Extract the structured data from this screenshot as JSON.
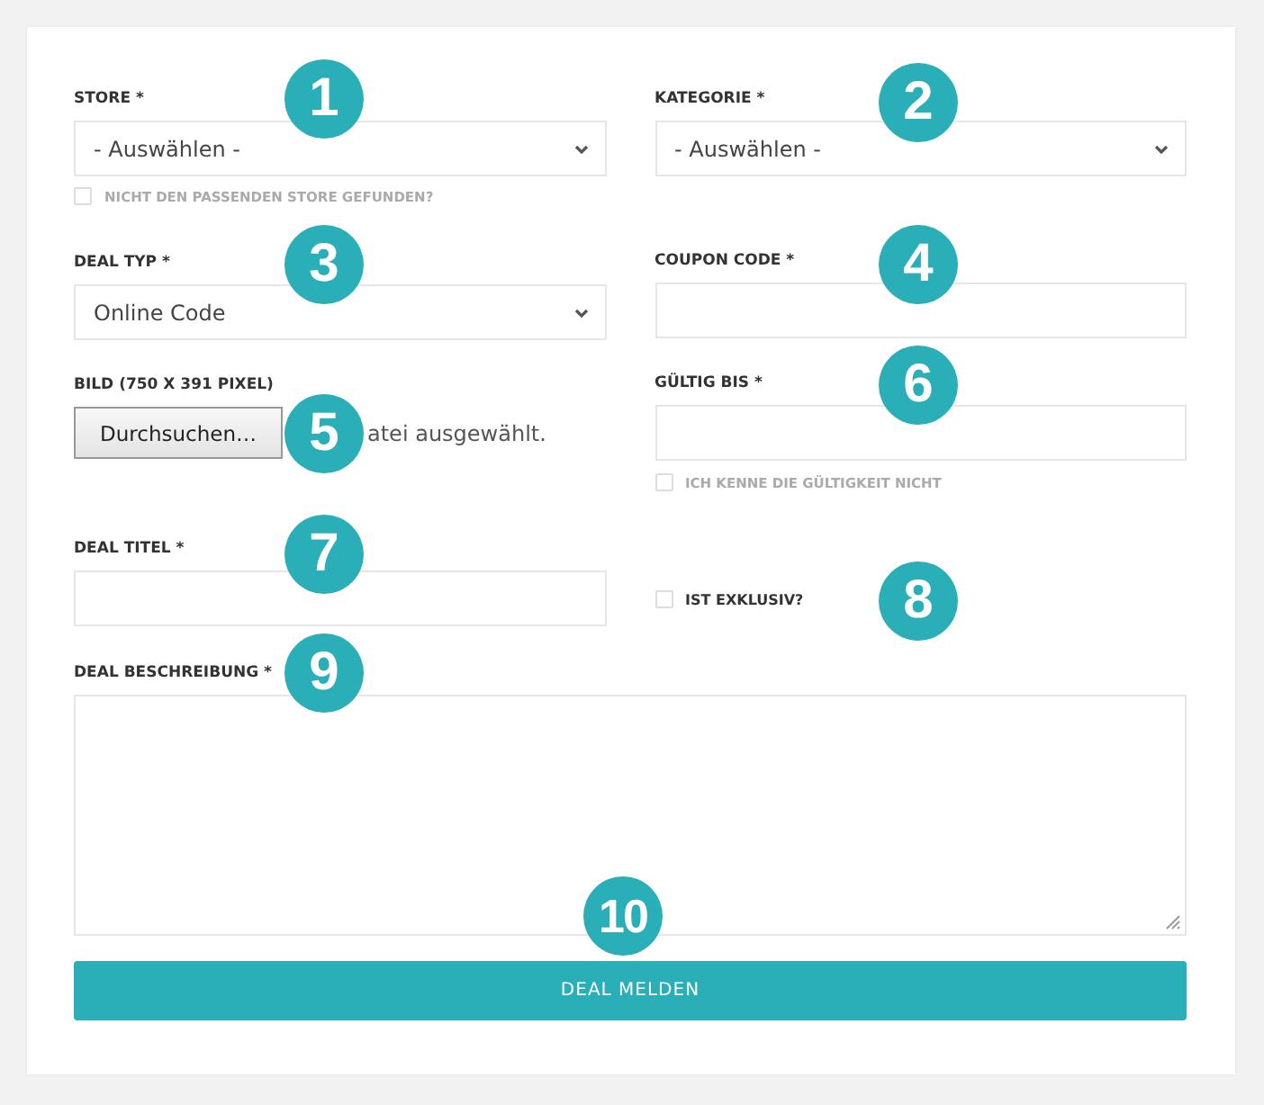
{
  "left_column": [
    {
      "kind": "select",
      "label": "STORE *",
      "value": "- Auswählen -"
    },
    {
      "kind": "checkbox",
      "label": "NICHT DEN PASSENDEN STORE GEFUNDEN?",
      "checked": false,
      "muted": true
    },
    {
      "kind": "select",
      "label": "DEAL TYP *",
      "value": "Online Code"
    },
    {
      "kind": "file",
      "label": "BILD (750 X 391 PIXEL)",
      "button": "Durchsuchen…",
      "status": "atei ausgewählt."
    },
    {
      "kind": "text",
      "label": "DEAL TITEL *"
    }
  ],
  "right_column": [
    {
      "kind": "select",
      "label": "KATEGORIE *",
      "value": "- Auswählen -"
    },
    {
      "kind": "text",
      "label": "COUPON CODE *"
    },
    {
      "kind": "text",
      "label": "GÜLTIG BIS *"
    },
    {
      "kind": "checkbox",
      "label": "ICH KENNE DIE GÜLTIGKEIT NICHT",
      "checked": false,
      "muted": true
    },
    {
      "kind": "checkbox",
      "label": "IST EXKLUSIV?",
      "checked": false,
      "muted": false
    }
  ],
  "description": {
    "label": "DEAL BESCHREIBUNG *"
  },
  "submit": {
    "label": "DEAL MELDEN"
  },
  "markers": [
    "1",
    "2",
    "3",
    "4",
    "5",
    "6",
    "7",
    "8",
    "9",
    "10"
  ]
}
